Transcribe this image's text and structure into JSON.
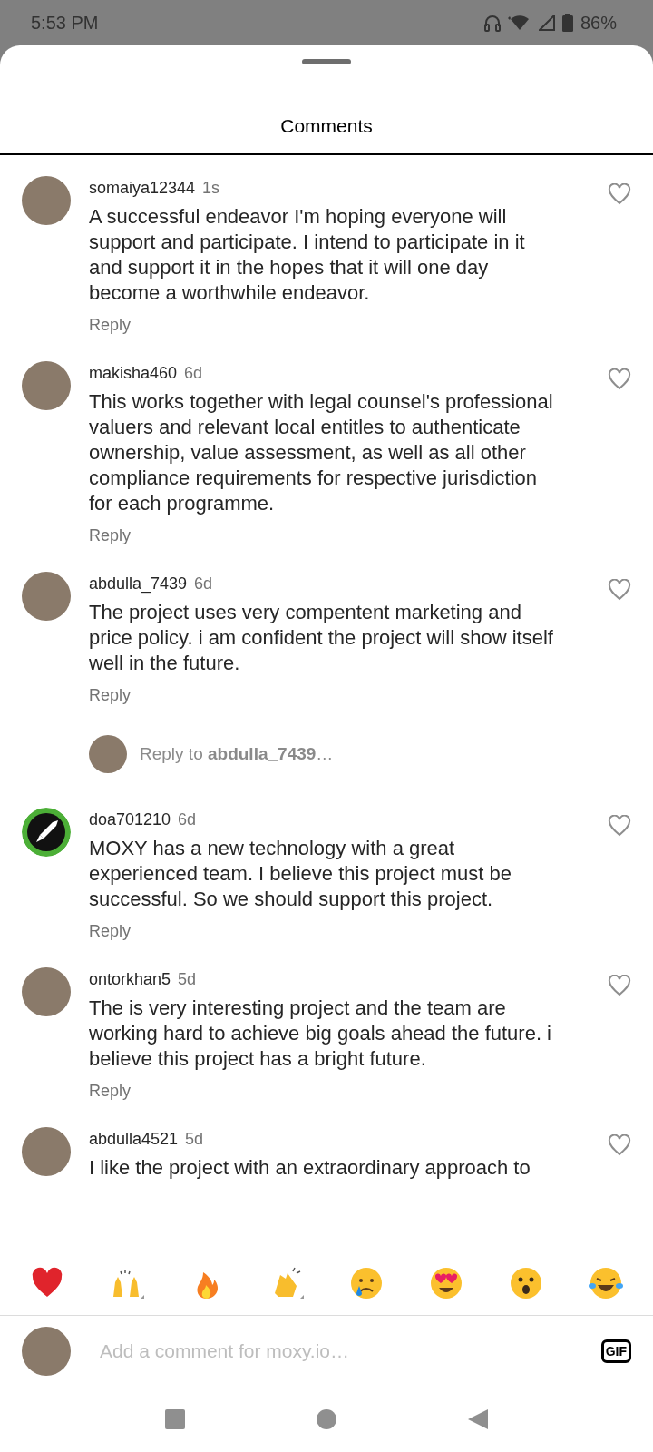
{
  "status_bar": {
    "time": "5:53 PM",
    "battery": "86%"
  },
  "sheet": {
    "title": "Comments"
  },
  "comments": [
    {
      "kind": "comment",
      "username": "somaiya12344",
      "age": "1s",
      "text": "A successful endeavor I'm hoping everyone will support and participate. I intend to participate in it and support it in the hopes that it will one day become a worthwhile endeavor.",
      "reply": "Reply",
      "avatar": {
        "kind": "photo"
      }
    },
    {
      "kind": "comment",
      "username": "makisha460",
      "age": "6d",
      "text": "This works  together with legal counsel's professional valuers and relevant local entitles to  authenticate ownership, value assessment, as well as all other compliance requirements for respective jurisdiction for each programme.",
      "reply": "Reply",
      "avatar": {
        "kind": "photo"
      }
    },
    {
      "kind": "comment",
      "username": "abdulla_7439",
      "age": "6d",
      "text": "The project uses very compentent marketing and price policy. i am confident the project will show itself well in the future.",
      "reply": "Reply",
      "avatar": {
        "kind": "photo"
      }
    },
    {
      "kind": "reply_prompt",
      "text": "Reply to **abdulla_7439**…"
    },
    {
      "kind": "comment",
      "username": "doa701210",
      "age": "6d",
      "text": "MOXY has a new technology with a great experienced team. I believe this project must be successful. So we should support this project.",
      "reply": "Reply",
      "avatar": {
        "kind": "logo"
      }
    },
    {
      "kind": "comment",
      "username": "ontorkhan5",
      "age": "5d",
      "text": "The is very interesting project and the team are working hard to achieve big goals ahead the future. i believe this project has a bright future.",
      "reply": "Reply",
      "avatar": {
        "kind": "photo"
      }
    },
    {
      "kind": "comment",
      "username": "abdulla4521",
      "age": "5d",
      "text": "I like the project with an extraordinary approach to",
      "avatar": {
        "kind": "photo"
      }
    }
  ],
  "composer": {
    "placeholder": "Add a comment for moxy.io…",
    "gif": "GIF"
  }
}
